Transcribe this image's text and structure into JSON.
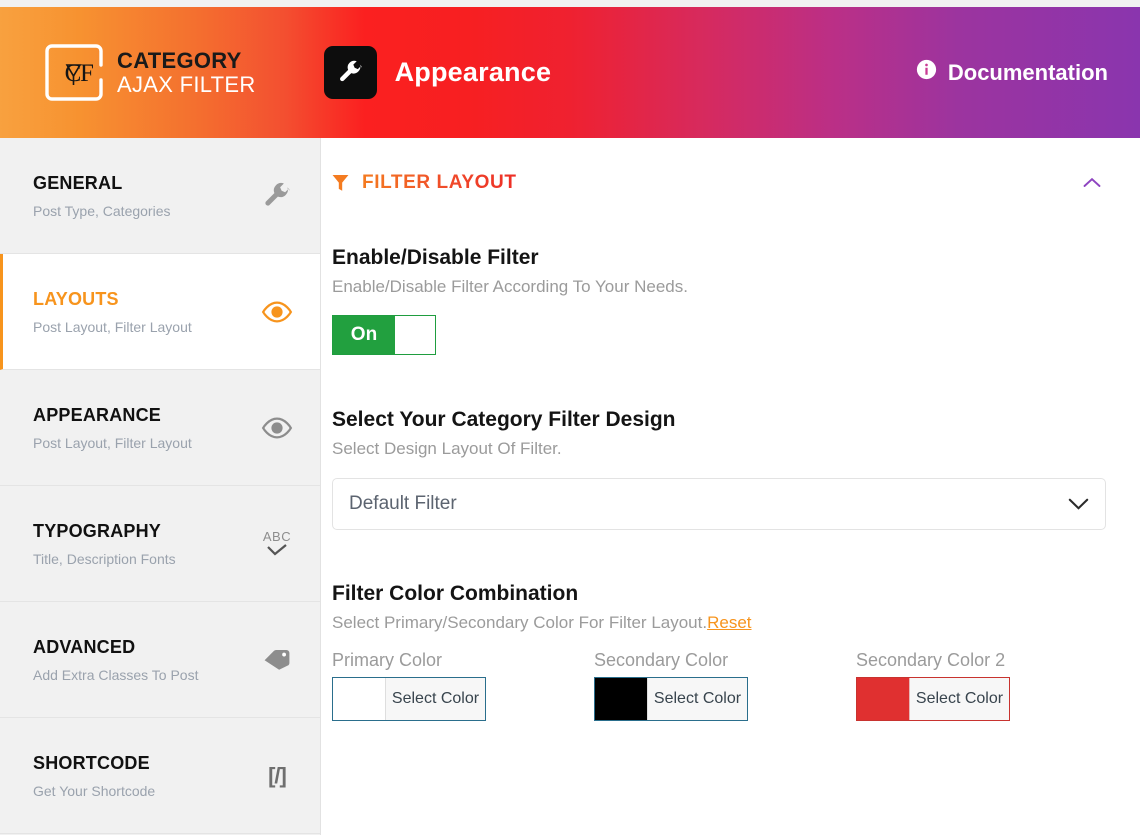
{
  "header": {
    "logo": {
      "mark_letters": "CAF",
      "line1": "CATEGORY",
      "line2": "AJAX FILTER",
      "icon": "logo-frame-icon"
    },
    "page_title": "Appearance",
    "page_title_icon": "wrench-icon",
    "documentation_label": "Documentation",
    "documentation_icon": "info-icon",
    "gradient_start": "#f8a13f",
    "gradient_mid": "#fb2020",
    "gradient_end": "#8a35ae"
  },
  "sidebar": {
    "items": [
      {
        "title": "GENERAL",
        "subtitle": "Post Type, Categories",
        "icon": "wrench-icon",
        "active": false
      },
      {
        "title": "LAYOUTS",
        "subtitle": "Post Layout, Filter Layout",
        "icon": "eye-icon",
        "active": true
      },
      {
        "title": "APPEARANCE",
        "subtitle": "Post Layout, Filter Layout",
        "icon": "eye-icon",
        "active": false
      },
      {
        "title": "TYPOGRAPHY",
        "subtitle": "Title, Description Fonts",
        "icon": "abc-check-icon",
        "active": false
      },
      {
        "title": "ADVANCED",
        "subtitle": "Add Extra Classes To Post",
        "icon": "tag-icon",
        "active": false
      },
      {
        "title": "SHORTCODE",
        "subtitle": "Get Your Shortcode",
        "icon": "code-brackets-icon",
        "active": false
      }
    ],
    "active_accent": "#f7941d"
  },
  "main": {
    "section": {
      "title": "FILTER LAYOUT",
      "icon": "funnel-icon",
      "collapse_icon": "chevron-up-icon"
    },
    "enable_filter": {
      "label": "Enable/Disable Filter",
      "description": "Enable/Disable Filter According To Your Needs.",
      "toggle_state": "On",
      "toggle_color": "#22a03f"
    },
    "filter_design": {
      "label": "Select Your Category Filter Design",
      "description": "Select Design Layout Of Filter.",
      "selected": "Default Filter",
      "options": [
        "Default Filter"
      ],
      "arrow_icon": "chevron-down-icon"
    },
    "color_combination": {
      "label": "Filter Color Combination",
      "description": "Select Primary/Secondary Color For Filter Layout.",
      "reset_label": "Reset",
      "pickers": [
        {
          "label": "Primary Color",
          "button_label": "Select Color",
          "value": "#ffffff",
          "border": "#2a6e8c"
        },
        {
          "label": "Secondary Color",
          "button_label": "Select Color",
          "value": "#000000",
          "border": "#2a6e8c"
        },
        {
          "label": "Secondary Color 2",
          "button_label": "Select Color",
          "value": "#e03030",
          "border": "#c8332f"
        }
      ]
    }
  }
}
